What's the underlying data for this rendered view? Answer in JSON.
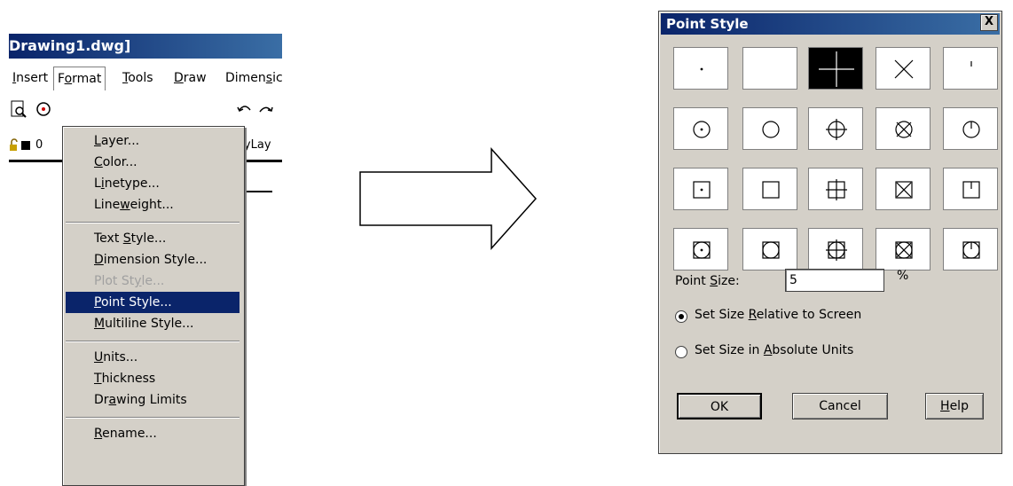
{
  "cad_window": {
    "title": "Drawing1.dwg]",
    "menubar": [
      {
        "label": "Insert",
        "underline": "I",
        "rest": "nsert"
      },
      {
        "label": "Format",
        "underline": "o",
        "pre": "F",
        "rest": "rmat"
      },
      {
        "label": "Tools",
        "underline": "T",
        "rest": "ools"
      },
      {
        "label": "Draw",
        "underline": "D",
        "rest": "raw"
      },
      {
        "label": "Dimensic",
        "pre": "Dimen",
        "underline": "s",
        "rest": "ic"
      }
    ],
    "layer_value": "0",
    "bylayer_label": "ByLay"
  },
  "format_menu": {
    "items": [
      {
        "pre": "",
        "u": "L",
        "post": "ayer...",
        "state": "normal"
      },
      {
        "pre": "",
        "u": "C",
        "post": "olor...",
        "state": "normal"
      },
      {
        "pre": "L",
        "u": "i",
        "post": "netype...",
        "state": "normal"
      },
      {
        "pre": "Line",
        "u": "w",
        "post": "eight...",
        "state": "normal"
      },
      {
        "pre": "Text ",
        "u": "S",
        "post": "tyle...",
        "state": "normal"
      },
      {
        "pre": "",
        "u": "D",
        "post": "imension Style...",
        "state": "normal"
      },
      {
        "pre": "Plot St",
        "u": "y",
        "post": "le...",
        "state": "disabled"
      },
      {
        "pre": "",
        "u": "P",
        "post": "oint Style...",
        "state": "highlight"
      },
      {
        "pre": "",
        "u": "M",
        "post": "ultiline Style...",
        "state": "normal"
      },
      {
        "pre": "",
        "u": "U",
        "post": "nits...",
        "state": "normal"
      },
      {
        "pre": "",
        "u": "T",
        "post": "hickness",
        "state": "normal"
      },
      {
        "pre": "Dr",
        "u": "a",
        "post": "wing Limits",
        "state": "normal"
      },
      {
        "pre": "",
        "u": "R",
        "post": "ename...",
        "state": "normal"
      }
    ]
  },
  "dialog": {
    "title": "Point Style",
    "close_label": "X",
    "grid_styles": [
      "dot",
      "none",
      "plus",
      "x",
      "tick",
      "circle-dot",
      "circle",
      "circle-plus",
      "circle-x",
      "circle-tick",
      "square-dot",
      "square",
      "square-plus",
      "square-x",
      "square-tick",
      "sqcirc-dot",
      "sqcirc",
      "sqcirc-plus",
      "sqcirc-x",
      "sqcirc-tick"
    ],
    "selected_index": 2,
    "point_size_label_pre": "Point ",
    "point_size_label_u": "S",
    "point_size_label_post": "ize:",
    "point_size_value": "5",
    "percent_sign": "%",
    "radio_relative": {
      "pre": "Set Size ",
      "u": "R",
      "post": "elative to Screen",
      "checked": true
    },
    "radio_absolute": {
      "pre": "Set Size in ",
      "u": "A",
      "post": "bsolute Units",
      "checked": false
    },
    "ok_label": "OK",
    "cancel_label": "Cancel",
    "help_pre": "",
    "help_u": "H",
    "help_post": "elp"
  }
}
